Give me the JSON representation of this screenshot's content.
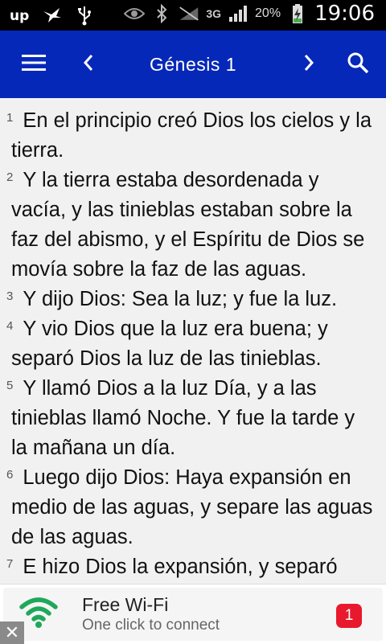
{
  "status_bar": {
    "left_icons": [
      "upwork-icon",
      "bird-notification-icon",
      "usb-icon"
    ],
    "network": "3G",
    "battery": "20%",
    "time": "19:06"
  },
  "app_bar": {
    "title": "Génesis 1"
  },
  "verses": [
    {
      "num": "1",
      "text": "En el principio creó Dios los cielos y la tierra."
    },
    {
      "num": "2",
      "text": "Y la tierra estaba desordenada y vacía, y las tinieblas estaban sobre la faz del abismo, y el Espíritu de Dios se movía sobre la faz de las aguas."
    },
    {
      "num": "3",
      "text": "Y dijo Dios: Sea la luz; y fue la luz."
    },
    {
      "num": "4",
      "text": "Y vio Dios que la luz era buena; y separó Dios la luz de las tinieblas."
    },
    {
      "num": "5",
      "text": "Y llamó Dios a la luz Día, y a las tinieblas llamó Noche. Y fue la tarde y la mañana un día."
    },
    {
      "num": "6",
      "text": "Luego dijo Dios: Haya expansión en medio de las aguas, y separe las aguas de las aguas."
    },
    {
      "num": "7",
      "text": "E hizo Dios la expansión, y separó"
    }
  ],
  "ad": {
    "title": "Free Wi-Fi",
    "subtitle": "One click to connect",
    "badge": "1",
    "close": "✕"
  },
  "colors": {
    "app_bar": "#0628b9",
    "status_bar": "#000000",
    "content_bg": "#f1f1f1",
    "badge": "#e8192c",
    "wifi_icon": "#1fa85a"
  }
}
